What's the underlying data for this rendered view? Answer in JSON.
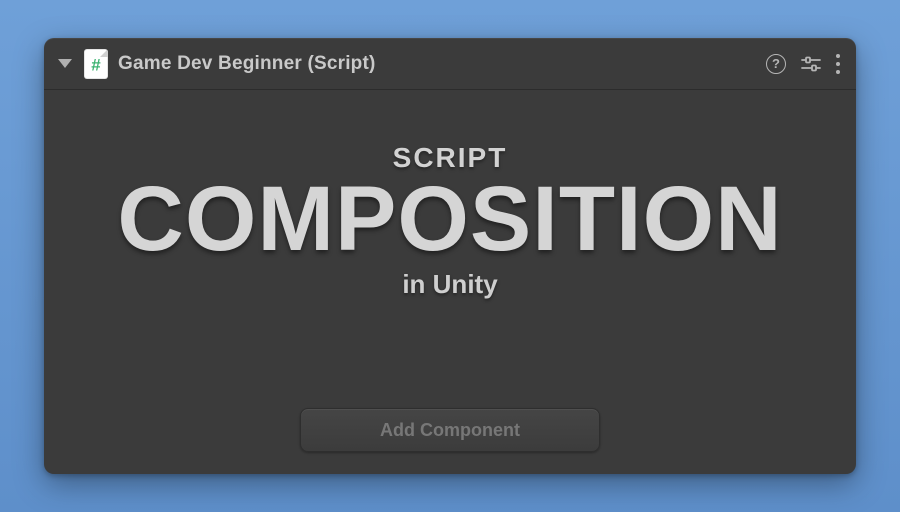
{
  "header": {
    "title": "Game Dev Beginner (Script)"
  },
  "hero": {
    "overline": "SCRIPT",
    "headline": "COMPOSITION",
    "subline": "in Unity"
  },
  "buttons": {
    "add_component": "Add Component"
  },
  "icons": {
    "script_hash": "#",
    "help_glyph": "?"
  }
}
